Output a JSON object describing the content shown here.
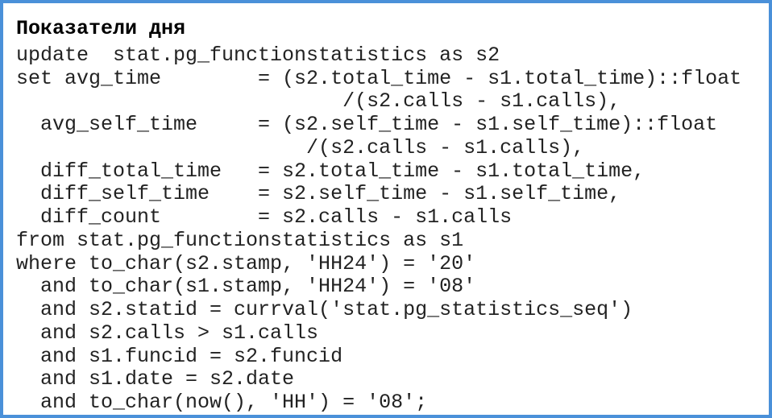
{
  "title": "Показатели дня",
  "code": "update  stat.pg_functionstatistics as s2\nset avg_time        = (s2.total_time - s1.total_time)::float\n                           /(s2.calls - s1.calls),\n  avg_self_time     = (s2.self_time - s1.self_time)::float\n                        /(s2.calls - s1.calls),\n  diff_total_time   = s2.total_time - s1.total_time,\n  diff_self_time    = s2.self_time - s1.self_time,\n  diff_count        = s2.calls - s1.calls\nfrom stat.pg_functionstatistics as s1\nwhere to_char(s2.stamp, 'HH24') = '20'\n  and to_char(s1.stamp, 'HH24') = '08'\n  and s2.statid = currval('stat.pg_statistics_seq')\n  and s2.calls > s1.calls\n  and s1.funcid = s2.funcid\n  and s1.date = s2.date\n  and to_char(now(), 'HH') = '08';"
}
